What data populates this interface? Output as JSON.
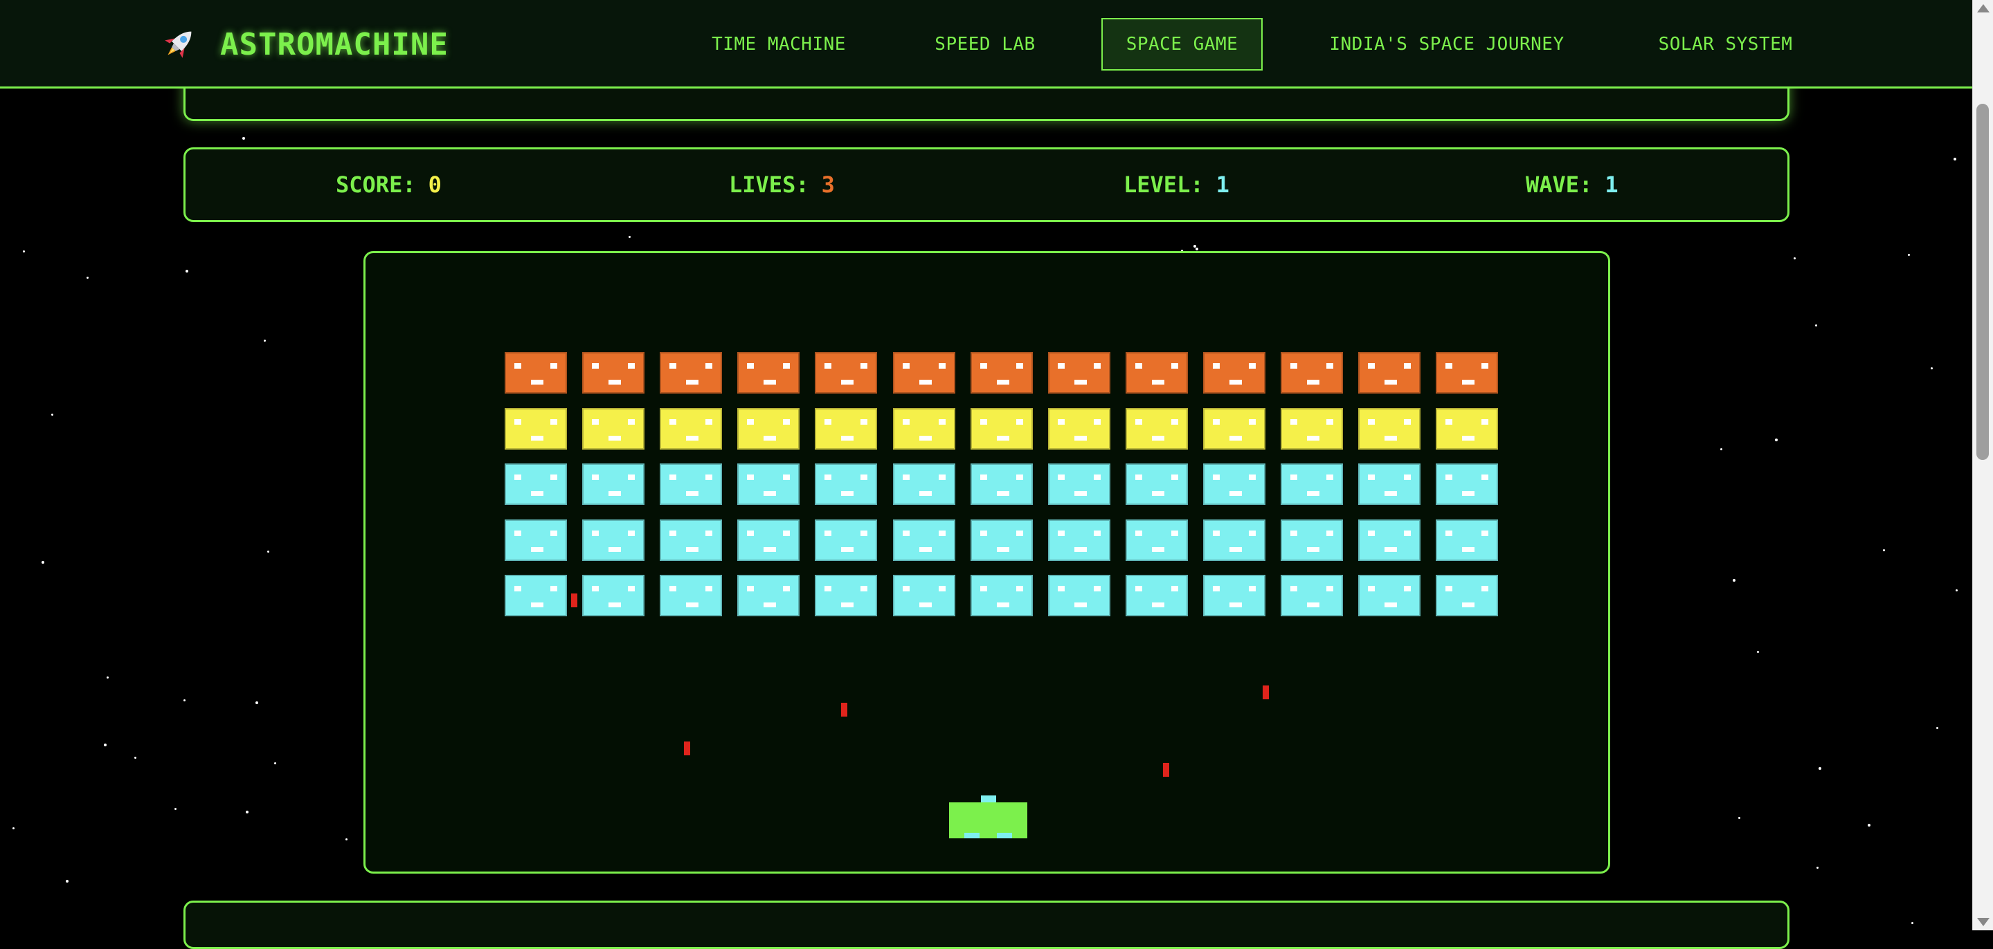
{
  "app": {
    "name": "ASTROMACHINE",
    "icon": "rocket-icon"
  },
  "nav": {
    "items": [
      {
        "label": "TIME MACHINE",
        "active": false
      },
      {
        "label": "SPEED LAB",
        "active": false
      },
      {
        "label": "SPACE GAME",
        "active": true
      },
      {
        "label": "INDIA'S SPACE JOURNEY",
        "active": false
      },
      {
        "label": "SOLAR SYSTEM",
        "active": false
      }
    ]
  },
  "stats": {
    "score": {
      "label": "SCORE:",
      "value": "0",
      "color": "#f5f04a"
    },
    "lives": {
      "label": "LIVES:",
      "value": "3",
      "color": "#e8702a"
    },
    "level": {
      "label": "LEVEL:",
      "value": "1",
      "color": "#7ff0f0"
    },
    "wave": {
      "label": "WAVE:",
      "value": "1",
      "color": "#7ff0f0"
    }
  },
  "game": {
    "invader_columns": 13,
    "invader_rows": [
      "orange",
      "yellow",
      "cyan",
      "cyan",
      "cyan"
    ],
    "enemy_bullets": 5,
    "player_ship": "player-ship"
  },
  "colors": {
    "accent": "#7cf04c",
    "orange": "#e8702a",
    "yellow": "#f5f04a",
    "cyan": "#7ff0f0",
    "bullet": "#e0241c",
    "background": "#000000"
  }
}
